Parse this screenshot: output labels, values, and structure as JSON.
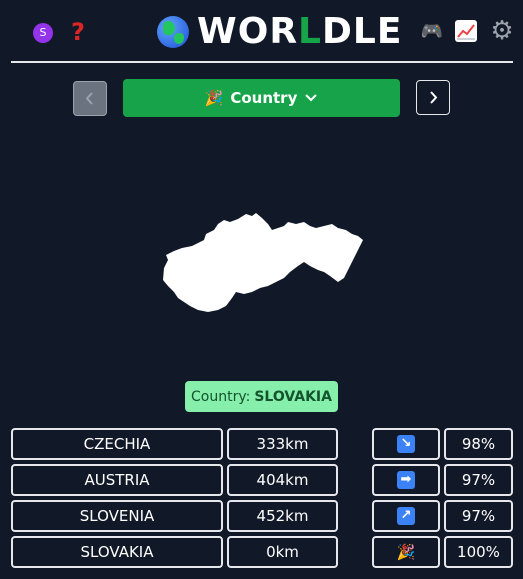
{
  "header": {
    "user_badge": "S",
    "help_icon": "question-mark-icon",
    "title_part1": "WOR",
    "title_part2": "L",
    "title_part3": "DLE",
    "icons": [
      "globe-icon",
      "game-controller-icon",
      "chart-increasing-icon",
      "gear-icon"
    ]
  },
  "mode": {
    "label": "Country",
    "icon": "party-popper-icon"
  },
  "answer": {
    "prefix": "Country:",
    "value": "SLOVAKIA"
  },
  "guesses": [
    {
      "country": "CZECHIA",
      "distance": "333km",
      "direction": "↘",
      "direction_icon": "arrow-down-right-icon",
      "percent": "98%"
    },
    {
      "country": "AUSTRIA",
      "distance": "404km",
      "direction": "➡",
      "direction_icon": "arrow-right-icon",
      "percent": "97%"
    },
    {
      "country": "SLOVENIA",
      "distance": "452km",
      "direction": "↗",
      "direction_icon": "arrow-up-right-icon",
      "percent": "97%"
    },
    {
      "country": "SLOVAKIA",
      "distance": "0km",
      "direction": "🎉",
      "direction_icon": "party-popper-icon",
      "percent": "100%"
    }
  ],
  "colors": {
    "background": "#111827",
    "accent_green": "#16a34a",
    "answer_bg": "#86efac",
    "direction_blue": "#3b82f6"
  }
}
